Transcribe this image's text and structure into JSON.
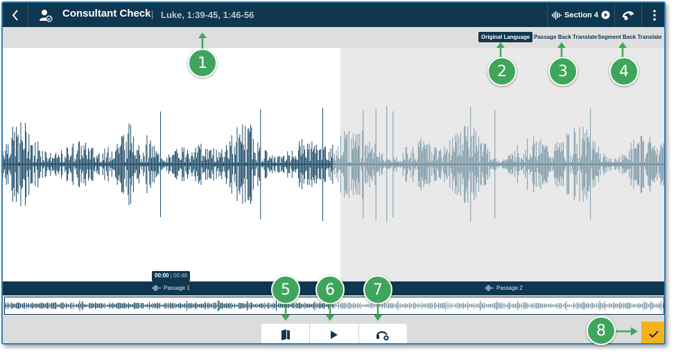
{
  "header": {
    "title": "Consultant Check",
    "separator": "|",
    "subtitle": "Luke, 1:39-45, 1:46-56",
    "section_label": "Section 4",
    "icons": {
      "back": "chevron-left-icon",
      "user": "user-check-icon",
      "section": "waveform-icon",
      "play": "play-circle-icon",
      "headset": "headset-icon",
      "more": "more-vertical-icon"
    }
  },
  "options": {
    "original_language": "Original Language",
    "passage_back_translate": "Passage Back Translate",
    "segment_back_translate": "Segment Back Translate"
  },
  "player": {
    "current_time": "00:00",
    "time_separator": "|",
    "total_time": "00:48",
    "passages": [
      "Passage 1",
      "Passage 2"
    ],
    "played_fraction": 0.5
  },
  "controls": {
    "icons": [
      "book-icon",
      "play-icon",
      "headset-add-icon"
    ],
    "approve_icon": "checkmark-icon"
  },
  "callouts": [
    "1",
    "2",
    "3",
    "4",
    "5",
    "6",
    "7",
    "8"
  ],
  "colors": {
    "navy": "#0f3750",
    "wave_played": "#1a4a66",
    "wave_unplayed": "#7d9aa9",
    "callout_green": "#3fa55b",
    "approve_yellow": "#f6b21b"
  }
}
